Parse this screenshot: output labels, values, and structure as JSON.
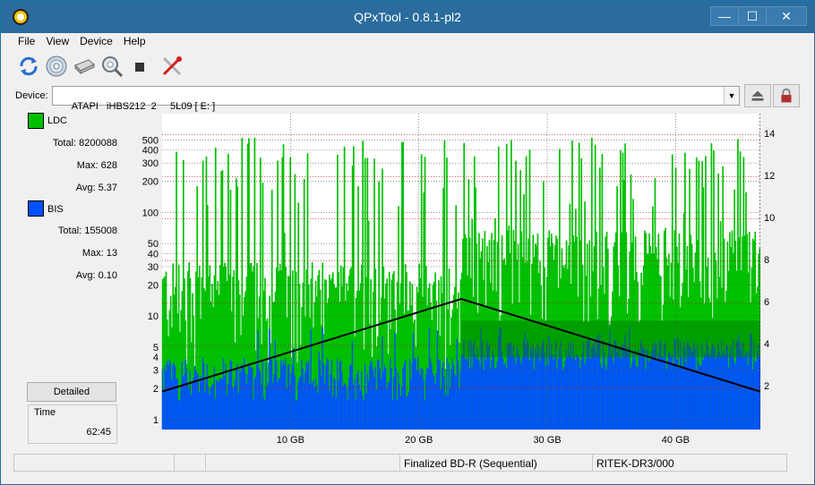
{
  "window": {
    "title": "QPxTool - 0.8.1-pl2",
    "min_label": "—",
    "max_label": "☐",
    "close_label": "✕"
  },
  "menu": [
    "File",
    "View",
    "Device",
    "Help"
  ],
  "toolbar": {
    "icons": [
      "refresh-icon",
      "disc-icon",
      "drive-icon",
      "scan-icon",
      "stop-icon",
      "tools-icon"
    ]
  },
  "device": {
    "label": "Device:",
    "value": "ATAPI   iHBS212  2     5L09 [ E: ]",
    "arrow": "▼"
  },
  "ldc": {
    "name": "LDC",
    "color": "#00c000",
    "total_label": "Total:",
    "total": "8200088",
    "max_label": "Max:",
    "max": "628",
    "avg_label": "Avg:",
    "avg": "5.37"
  },
  "bis": {
    "name": "BIS",
    "color": "#0050ff",
    "total_label": "Total:",
    "total": "155008",
    "max_label": "Max:",
    "max": "13",
    "avg_label": "Avg:",
    "avg": "0.10"
  },
  "detailed_label": "Detailed",
  "time": {
    "label": "Time",
    "value": "62:45"
  },
  "status": {
    "disc": "Finalized BD-R (Sequential)",
    "media": "RITEK-DR3/000"
  },
  "chart_data": {
    "type": "area",
    "x_unit": "GB",
    "x_ticks": [
      "10 GB",
      "20 GB",
      "30 GB",
      "40 GB"
    ],
    "x_tick_values": [
      10,
      20,
      30,
      40
    ],
    "xlim": [
      0,
      46.6
    ],
    "y_left_scale": "log",
    "y_left_ticks": [
      "1",
      "2",
      "3",
      "4",
      "5",
      "10",
      "20",
      "30",
      "40",
      "50",
      "100",
      "200",
      "300",
      "400",
      "500"
    ],
    "y_left_tick_values": [
      1,
      2,
      3,
      4,
      5,
      10,
      20,
      30,
      40,
      50,
      100,
      200,
      300,
      400,
      500
    ],
    "ylim_left": [
      0.8,
      900
    ],
    "y_right_ticks": [
      "2",
      "4",
      "6",
      "8",
      "10",
      "12",
      "14"
    ],
    "y_right_tick_values": [
      2,
      4,
      6,
      8,
      10,
      12,
      14
    ],
    "ylim_right": [
      0,
      15
    ],
    "layer_end_gb": 23.3,
    "series": [
      {
        "name": "LDC",
        "color": "#00c000",
        "max": 628
      },
      {
        "name": "BIS",
        "color": "#0050ff",
        "max": 13
      },
      {
        "color": "#000000",
        "x": [
          0,
          23.3,
          46.6
        ],
        "y": [
          1.8,
          6.2,
          1.8
        ]
      }
    ],
    "grid": true
  }
}
